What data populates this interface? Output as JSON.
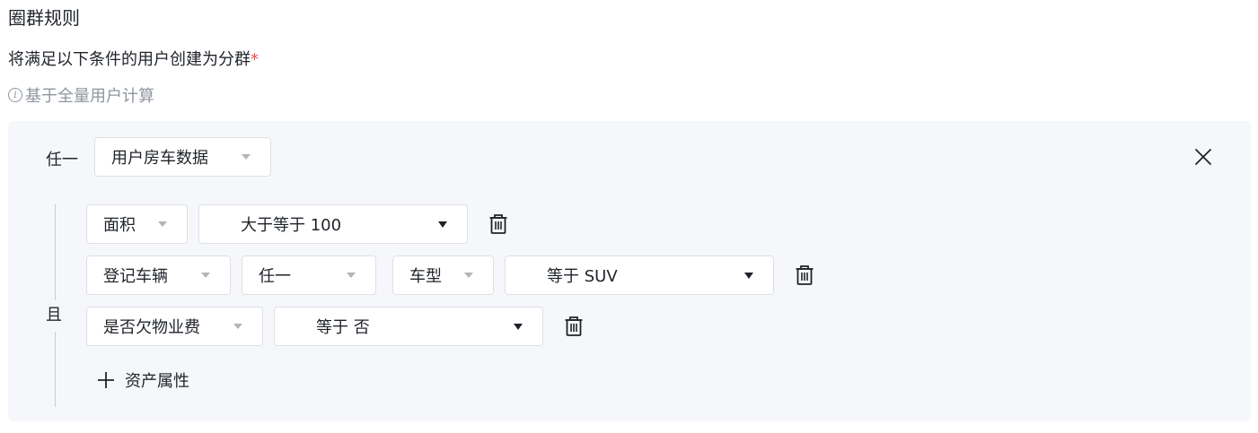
{
  "header": {
    "title": "圈群规则",
    "description": "将满足以下条件的用户创建为分群",
    "required_mark": "*",
    "hint": "基于全量用户计算",
    "hint_icon": "info-icon"
  },
  "group": {
    "match_mode_label": "任一",
    "category_select": "用户房车数据",
    "close_icon": "close-icon",
    "logic_label": "且",
    "conditions": [
      {
        "field": "面积",
        "condition": "大于等于 100"
      },
      {
        "field": "登记车辆",
        "mode": "任一",
        "subfield": "车型",
        "condition": "等于 SUV"
      },
      {
        "field": "是否欠物业费",
        "condition": "等于 否"
      }
    ],
    "delete_icon": "trash-icon",
    "add_label": "资产属性",
    "add_icon": "plus-icon"
  },
  "colors": {
    "panel_bg": "#f5f7fa",
    "required": "#f54a45",
    "hint": "#8f959e"
  }
}
